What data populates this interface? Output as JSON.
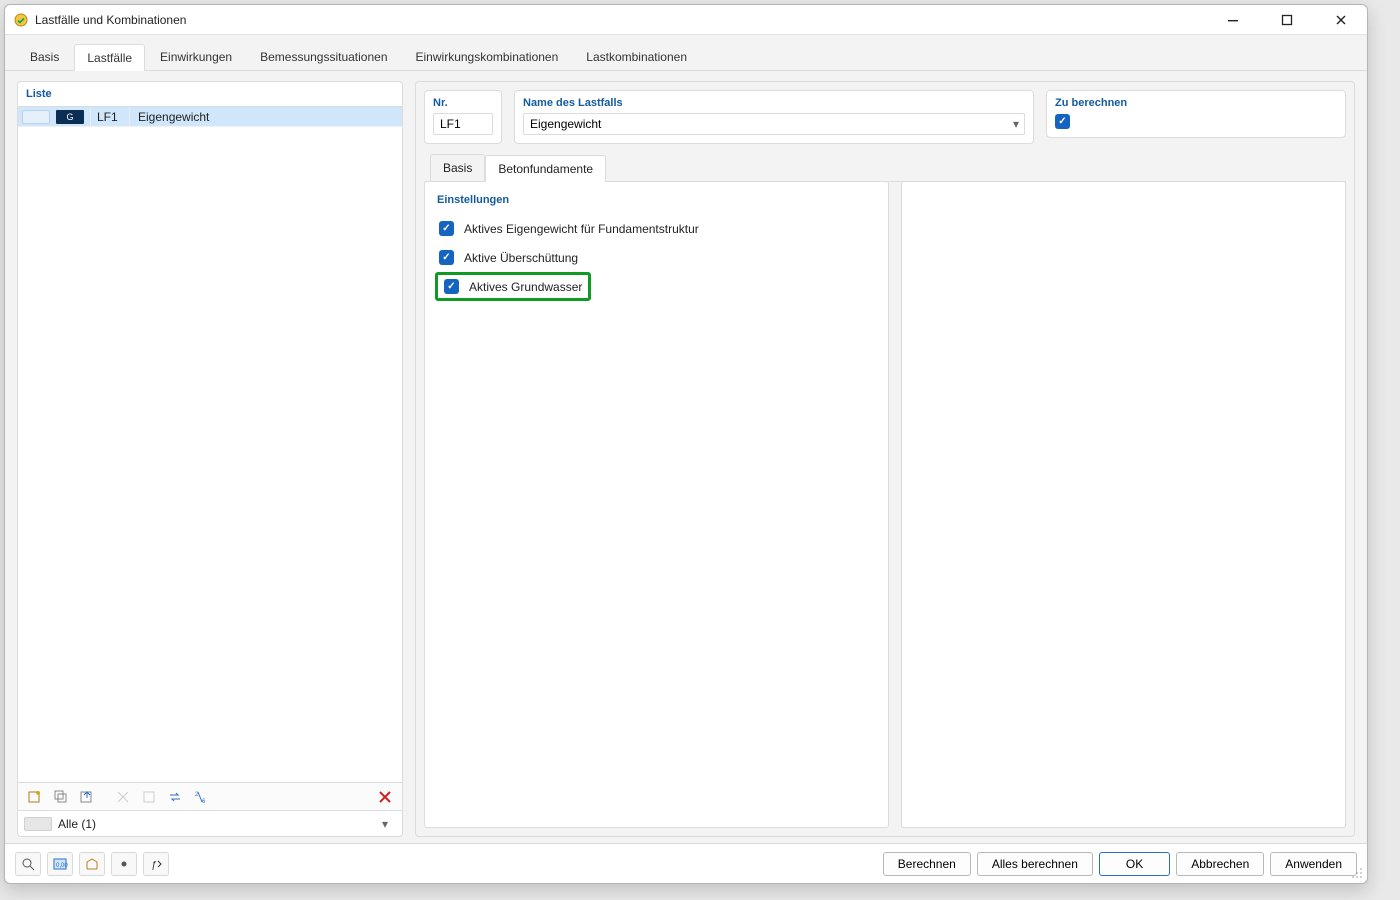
{
  "window": {
    "title": "Lastfälle und Kombinationen"
  },
  "tabs": {
    "items": [
      {
        "label": "Basis"
      },
      {
        "label": "Lastfälle"
      },
      {
        "label": "Einwirkungen"
      },
      {
        "label": "Bemessungssituationen"
      },
      {
        "label": "Einwirkungskombinationen"
      },
      {
        "label": "Lastkombinationen"
      }
    ],
    "activeIndex": 1
  },
  "left": {
    "header": "Liste",
    "row": {
      "badge": "G",
      "code": "LF1",
      "name": "Eigengewicht"
    },
    "filter": {
      "label": "Alle (1)"
    }
  },
  "right": {
    "nr": {
      "label": "Nr.",
      "value": "LF1"
    },
    "name": {
      "label": "Name des Lastfalls",
      "value": "Eigengewicht"
    },
    "calc": {
      "label": "Zu berechnen",
      "checked": true
    },
    "subTabs": {
      "items": [
        {
          "label": "Basis"
        },
        {
          "label": "Betonfundamente"
        }
      ],
      "activeIndex": 1
    },
    "settings": {
      "title": "Einstellungen",
      "items": [
        {
          "label": "Aktives Eigengewicht für Fundamentstruktur",
          "checked": true
        },
        {
          "label": "Aktive Überschüttung",
          "checked": true
        },
        {
          "label": "Aktives Grundwasser",
          "checked": true,
          "highlight": true
        }
      ]
    }
  },
  "footer": {
    "buttons": {
      "calculate": "Berechnen",
      "calculateAll": "Alles berechnen",
      "ok": "OK",
      "cancel": "Abbrechen",
      "apply": "Anwenden"
    }
  },
  "icons": {
    "min": "minimize-icon",
    "max": "maximize-icon",
    "close": "close-icon"
  }
}
